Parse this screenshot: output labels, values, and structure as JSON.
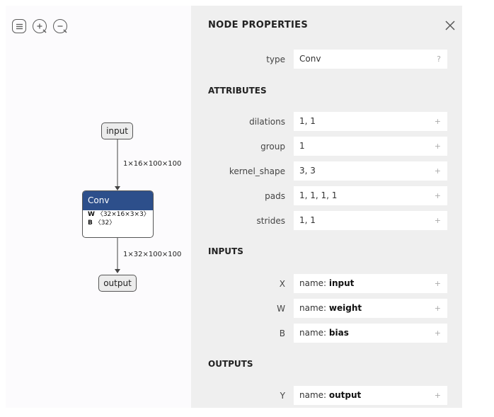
{
  "toolbar": {
    "menu_icon": "menu-icon",
    "zoom_in_icon": "zoom-in-icon",
    "zoom_out_icon": "zoom-out-icon"
  },
  "graph": {
    "input_node": "input",
    "output_node": "output",
    "edge_top": "1×16×100×100",
    "edge_bottom": "1×32×100×100",
    "conv": {
      "title": "Conv",
      "w_name": "W",
      "w_shape": "〈32×16×3×3〉",
      "b_name": "B",
      "b_shape": "〈32〉",
      "header_color": "#2d4f8b"
    }
  },
  "panel": {
    "title": "NODE PROPERTIES",
    "type_label": "type",
    "type_value": "Conv",
    "type_action": "?",
    "sections": {
      "attributes": "ATTRIBUTES",
      "inputs": "INPUTS",
      "outputs": "OUTPUTS"
    },
    "attributes": [
      {
        "label": "dilations",
        "value": "1, 1"
      },
      {
        "label": "group",
        "value": "1"
      },
      {
        "label": "kernel_shape",
        "value": "3, 3"
      },
      {
        "label": "pads",
        "value": "1, 1, 1, 1"
      },
      {
        "label": "strides",
        "value": "1, 1"
      }
    ],
    "inputs": [
      {
        "label": "X",
        "key": "name: ",
        "value": "input"
      },
      {
        "label": "W",
        "key": "name: ",
        "value": "weight"
      },
      {
        "label": "B",
        "key": "name: ",
        "value": "bias"
      }
    ],
    "outputs": [
      {
        "label": "Y",
        "key": "name: ",
        "value": "output"
      }
    ],
    "expand_symbol": "+"
  }
}
